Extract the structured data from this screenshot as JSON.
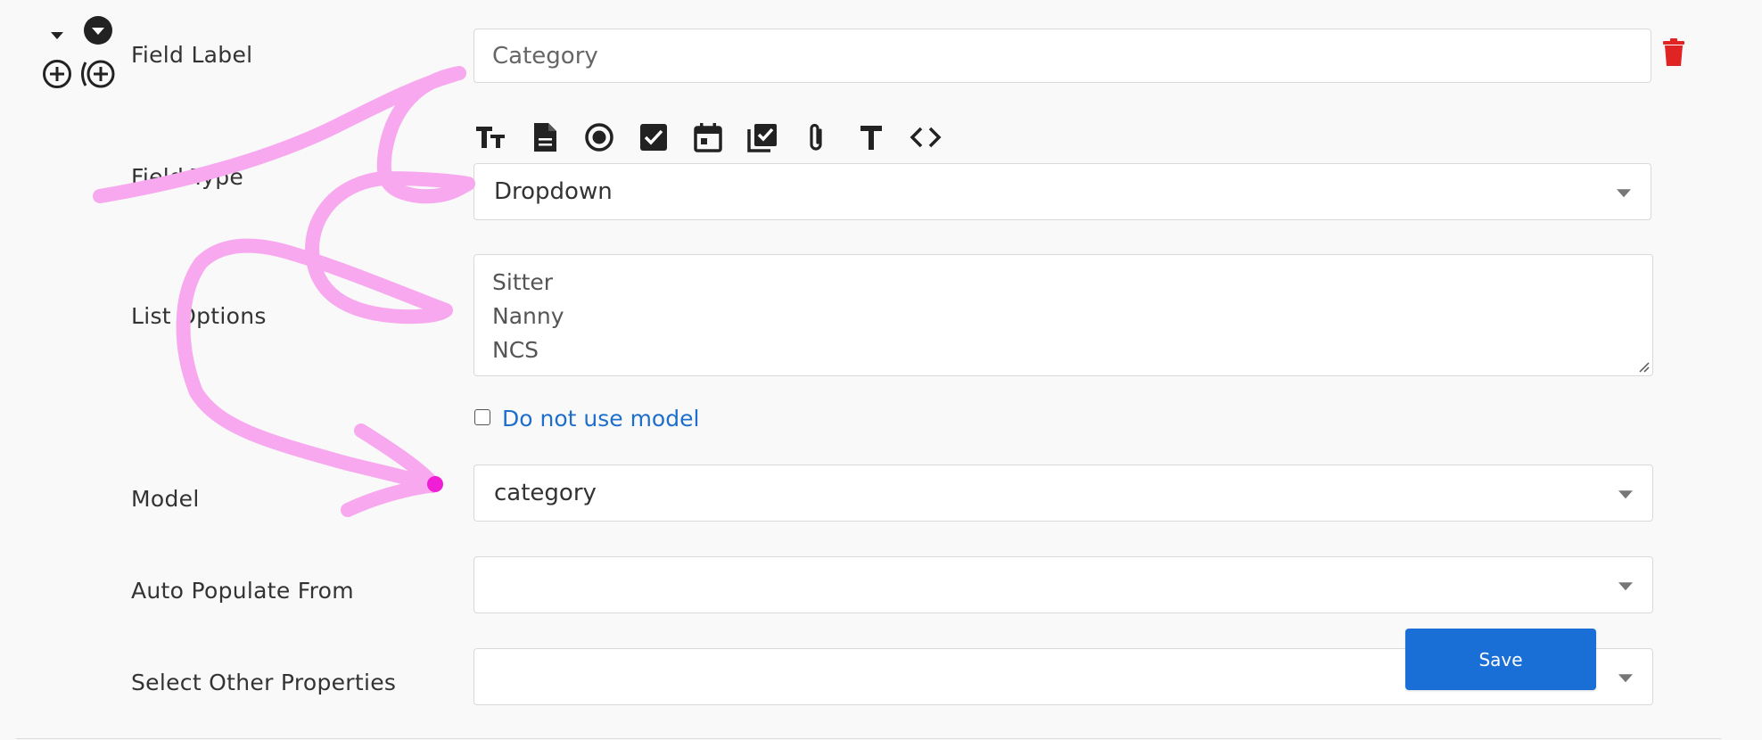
{
  "form": {
    "field_label": {
      "label": "Field Label",
      "value": "Category"
    },
    "field_type": {
      "label": "Field Type",
      "value": "Dropdown",
      "type_icons": [
        "text-size-icon",
        "document-icon",
        "radio-icon",
        "checkbox-icon",
        "calendar-icon",
        "checklist-icon",
        "paperclip-icon",
        "text-icon",
        "code-icon"
      ]
    },
    "list_options": {
      "label": "List Options",
      "lines": [
        "Sitter",
        "Nanny",
        "NCS"
      ]
    },
    "do_not_use_model": {
      "label": "Do not use model",
      "checked": false
    },
    "model": {
      "label": "Model",
      "value": "category"
    },
    "auto_populate": {
      "label": "Auto Populate From",
      "value": ""
    },
    "other_properties": {
      "label": "Select Other Properties",
      "value": ""
    }
  },
  "actions": {
    "save_label": "Save"
  },
  "colors": {
    "accent": "#1a6fd6",
    "delete": "#e02424",
    "link": "#1e6fcc",
    "annotation": "#f7a8ee",
    "annotation_dot": "#f01fd6"
  }
}
